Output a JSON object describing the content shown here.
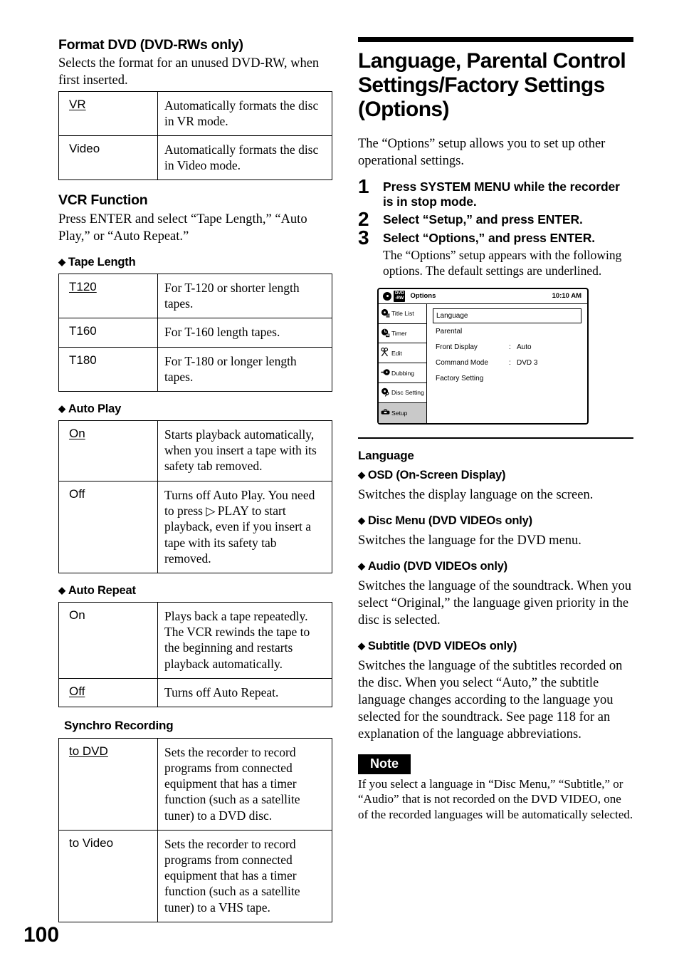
{
  "page_number": "100",
  "left_column": {
    "format_dvd": {
      "heading": "Format DVD (DVD-RWs only)",
      "intro": "Selects the format for an unused DVD-RW, when first inserted.",
      "rows": [
        {
          "key": "VR",
          "underlined": true,
          "desc": "Automatically formats the disc in VR mode."
        },
        {
          "key": "Video",
          "underlined": false,
          "desc": "Automatically formats the disc in Video mode."
        }
      ]
    },
    "vcr_function": {
      "heading": "VCR Function",
      "intro": "Press ENTER and select “Tape Length,” “Auto Play,” or “Auto Repeat.”",
      "tape_length": {
        "heading": "Tape Length",
        "rows": [
          {
            "key": "T120",
            "underlined": true,
            "desc": "For T-120 or shorter length tapes."
          },
          {
            "key": "T160",
            "underlined": false,
            "desc": "For T-160 length tapes."
          },
          {
            "key": "T180",
            "underlined": false,
            "desc": "For T-180 or longer length tapes."
          }
        ]
      },
      "auto_play": {
        "heading": "Auto Play",
        "rows": [
          {
            "key": "On",
            "underlined": true,
            "desc": "Starts playback automatically, when you insert a tape with its safety tab removed."
          },
          {
            "key": "Off",
            "underlined": false,
            "desc_before": "Turns off Auto Play. You need to press ",
            "play_glyph": "▷",
            "desc_after": " PLAY to start playback, even if you insert a tape with its safety tab removed."
          }
        ]
      },
      "auto_repeat": {
        "heading": "Auto Repeat",
        "rows": [
          {
            "key": "On",
            "underlined": false,
            "desc": "Plays back a tape repeatedly. The VCR rewinds the tape to the beginning and restarts playback automatically."
          },
          {
            "key": "Off",
            "underlined": true,
            "desc": "Turns off Auto Repeat."
          }
        ]
      }
    },
    "synchro_recording": {
      "heading": "Synchro Recording",
      "rows": [
        {
          "key": "to DVD",
          "underlined": true,
          "desc": "Sets the recorder to record programs from connected equipment that has a timer function (such as a satellite tuner) to a DVD disc."
        },
        {
          "key": "to Video",
          "underlined": false,
          "desc": "Sets the recorder to record programs from connected equipment that has a timer function (such as a satellite tuner) to a VHS tape."
        }
      ]
    }
  },
  "right_column": {
    "title": "Language, Parental Control Settings/Factory Settings (Options)",
    "intro": "The “Options” setup allows you to set up other operational settings.",
    "steps": [
      {
        "num": "1",
        "text": "Press SYSTEM MENU while the recorder is in stop mode."
      },
      {
        "num": "2",
        "text": "Select “Setup,” and press ENTER."
      },
      {
        "num": "3",
        "text": "Select “Options,” and press ENTER.",
        "sub": "The “Options” setup appears with the following options. The default settings are underlined."
      }
    ],
    "osd_screen": {
      "disc_badge": "DVD\n-RW",
      "disc_badge_line1": "DVD",
      "disc_badge_line2": "-RW",
      "title": "Options",
      "clock": "10:10 AM",
      "sidebar": [
        {
          "label": "Title List",
          "icon": "disc-list-icon",
          "selected": false
        },
        {
          "label": "Timer",
          "icon": "clock-icon",
          "selected": false
        },
        {
          "label": "Edit",
          "icon": "scissors-icon",
          "selected": false
        },
        {
          "label": "Dubbing",
          "icon": "dubbing-arrow-disc-icon",
          "selected": false
        },
        {
          "label": "Disc Setting",
          "icon": "disc-wrench-icon",
          "selected": false
        },
        {
          "label": "Setup",
          "icon": "toolbox-icon",
          "selected": true
        }
      ],
      "menu_items": [
        {
          "label": "Language",
          "value": "",
          "boxed": true
        },
        {
          "label": "Parental",
          "value": "",
          "boxed": false
        },
        {
          "label": "Front Display",
          "colon": ":",
          "value": "Auto",
          "boxed": false
        },
        {
          "label": "Command Mode",
          "colon": ":",
          "value": "DVD 3",
          "boxed": false
        },
        {
          "label": "Factory Setting",
          "value": "",
          "boxed": false
        }
      ]
    },
    "language_section": {
      "heading": "Language",
      "items": [
        {
          "heading": "OSD (On-Screen Display)",
          "body": "Switches the display language on the screen."
        },
        {
          "heading": "Disc Menu (DVD VIDEOs only)",
          "body": "Switches the language for the DVD menu."
        },
        {
          "heading": "Audio (DVD VIDEOs only)",
          "body": "Switches the language of the soundtrack.\nWhen you select “Original,” the language given priority in the disc is selected."
        },
        {
          "heading": "Subtitle (DVD VIDEOs only)",
          "body": "Switches the language of the subtitles recorded on the disc.\nWhen you select “Auto,” the subtitle language changes according to the language you selected for the soundtrack. See page 118 for an explanation of the language abbreviations."
        }
      ]
    },
    "note": {
      "label": "Note",
      "body": "If you select a language in “Disc Menu,” “Subtitle,” or “Audio” that is not recorded on the DVD VIDEO, one of the recorded languages will be automatically selected."
    }
  }
}
